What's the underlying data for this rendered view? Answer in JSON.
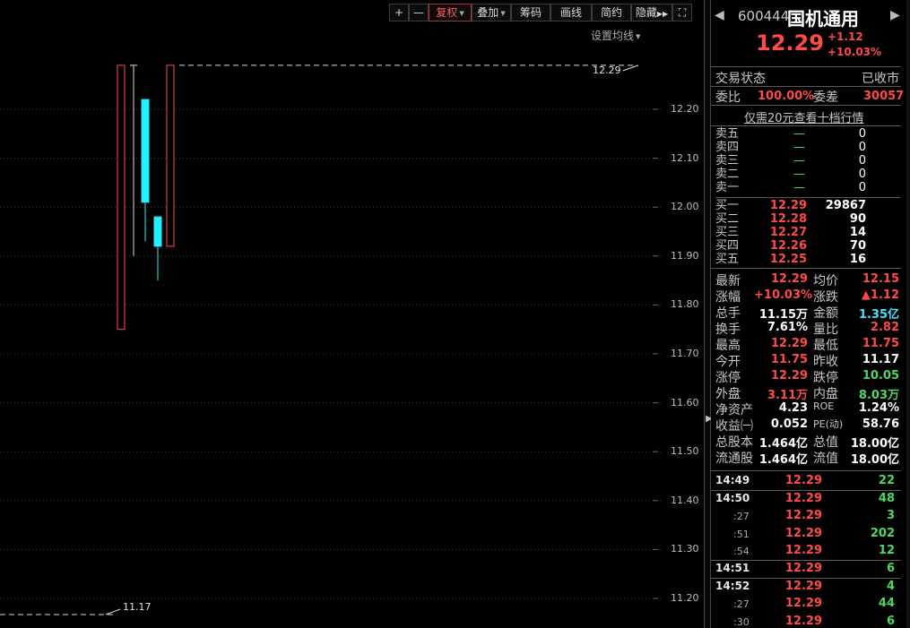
{
  "toolbar": {
    "plus": "+",
    "minus": "—",
    "fuquan": "复权",
    "diejia": "叠加",
    "chouma": "筹码",
    "huaxian": "画线",
    "jianyue": "简约",
    "yincang": "隐藏",
    "expand": "⛶",
    "setting_ma": "设置均线"
  },
  "chart_data": {
    "type": "candlestick",
    "y_ticks": [
      "12.20",
      "12.10",
      "12.00",
      "11.90",
      "11.80",
      "11.70",
      "11.60",
      "11.50",
      "11.40",
      "11.30",
      "11.20"
    ],
    "ylim": [
      11.17,
      12.29
    ],
    "candles": [
      {
        "open": 11.75,
        "close": 12.29,
        "high": 12.29,
        "low": 11.75,
        "color": "red"
      },
      {
        "open": 12.29,
        "close": 12.29,
        "high": 12.29,
        "low": 11.9,
        "color": "white"
      },
      {
        "open": 12.22,
        "close": 12.01,
        "high": 12.22,
        "low": 11.93,
        "color": "cyan"
      },
      {
        "open": 11.98,
        "close": 11.92,
        "high": 11.98,
        "low": 11.85,
        "color": "cyan"
      },
      {
        "open": 11.92,
        "close": 12.29,
        "high": 12.29,
        "low": 11.92,
        "color": "red"
      }
    ],
    "annotations": {
      "high_label": "12.29",
      "low_label": "11.17"
    }
  },
  "quote": {
    "code": "600444",
    "name": "国机通用",
    "price": "12.29",
    "change": "+1.12",
    "pct": "+10.03%",
    "status_label": "交易状态",
    "status_value": "已收市",
    "weibi_label": "委比",
    "weibi_value": "100.00%",
    "weicha_label": "委差",
    "weicha_value": "30057",
    "promo": "仅需20元查看十档行情"
  },
  "asks": [
    {
      "label": "卖五",
      "price": "—",
      "vol": "0"
    },
    {
      "label": "卖四",
      "price": "—",
      "vol": "0"
    },
    {
      "label": "卖三",
      "price": "—",
      "vol": "0"
    },
    {
      "label": "卖二",
      "price": "—",
      "vol": "0"
    },
    {
      "label": "卖一",
      "price": "—",
      "vol": "0"
    }
  ],
  "bids": [
    {
      "label": "买一",
      "price": "12.29",
      "vol": "29867"
    },
    {
      "label": "买二",
      "price": "12.28",
      "vol": "90"
    },
    {
      "label": "买三",
      "price": "12.27",
      "vol": "14"
    },
    {
      "label": "买四",
      "price": "12.26",
      "vol": "70"
    },
    {
      "label": "买五",
      "price": "12.25",
      "vol": "16"
    }
  ],
  "stats": [
    {
      "l1": "最新",
      "v1": "12.29",
      "c1": "red",
      "l2": "均价",
      "v2": "12.15",
      "c2": "red"
    },
    {
      "l1": "涨幅",
      "v1": "+10.03%",
      "c1": "red",
      "l2": "涨跌",
      "v2": "▲1.12",
      "c2": "red"
    },
    {
      "l1": "总手",
      "v1": "11.15万",
      "c1": "white",
      "l2": "金额",
      "v2": "1.35亿",
      "c2": "cyan"
    },
    {
      "l1": "换手",
      "v1": "7.61%",
      "c1": "white",
      "l2": "量比",
      "v2": "2.82",
      "c2": "red"
    },
    {
      "l1": "最高",
      "v1": "12.29",
      "c1": "red",
      "l2": "最低",
      "v2": "11.75",
      "c2": "red"
    },
    {
      "l1": "今开",
      "v1": "11.75",
      "c1": "red",
      "l2": "昨收",
      "v2": "11.17",
      "c2": "white"
    },
    {
      "l1": "涨停",
      "v1": "12.29",
      "c1": "red",
      "l2": "跌停",
      "v2": "10.05",
      "c2": "green"
    },
    {
      "l1": "外盘",
      "v1": "3.11万",
      "c1": "red",
      "l2": "内盘",
      "v2": "8.03万",
      "c2": "green"
    },
    {
      "l1": "净资产",
      "v1": "4.23",
      "c1": "white",
      "l2": "ROE",
      "v2": "1.24%",
      "c2": "white"
    },
    {
      "l1": "收益㈠",
      "v1": "0.052",
      "c1": "white",
      "l2": "PE(动)",
      "v2": "58.76",
      "c2": "white"
    },
    {
      "l1": "总股本",
      "v1": "1.464亿",
      "c1": "white",
      "l2": "总值",
      "v2": "18.00亿",
      "c2": "white"
    },
    {
      "l1": "流通股",
      "v1": "1.464亿",
      "c1": "white",
      "l2": "流值",
      "v2": "18.00亿",
      "c2": "white"
    }
  ],
  "ticks": [
    {
      "time": "14:49",
      "price": "12.29",
      "vol": "22",
      "major": true
    },
    {
      "time": "14:50",
      "price": "12.29",
      "vol": "48",
      "major": true
    },
    {
      "time": ":27",
      "price": "12.29",
      "vol": "3",
      "major": false
    },
    {
      "time": ":51",
      "price": "12.29",
      "vol": "202",
      "major": false
    },
    {
      "time": ":54",
      "price": "12.29",
      "vol": "12",
      "major": false
    },
    {
      "time": "14:51",
      "price": "12.29",
      "vol": "6",
      "major": true
    },
    {
      "time": "14:52",
      "price": "12.29",
      "vol": "4",
      "major": true
    },
    {
      "time": ":27",
      "price": "12.29",
      "vol": "44",
      "major": false
    },
    {
      "time": ":30",
      "price": "12.29",
      "vol": "6",
      "major": false
    }
  ]
}
